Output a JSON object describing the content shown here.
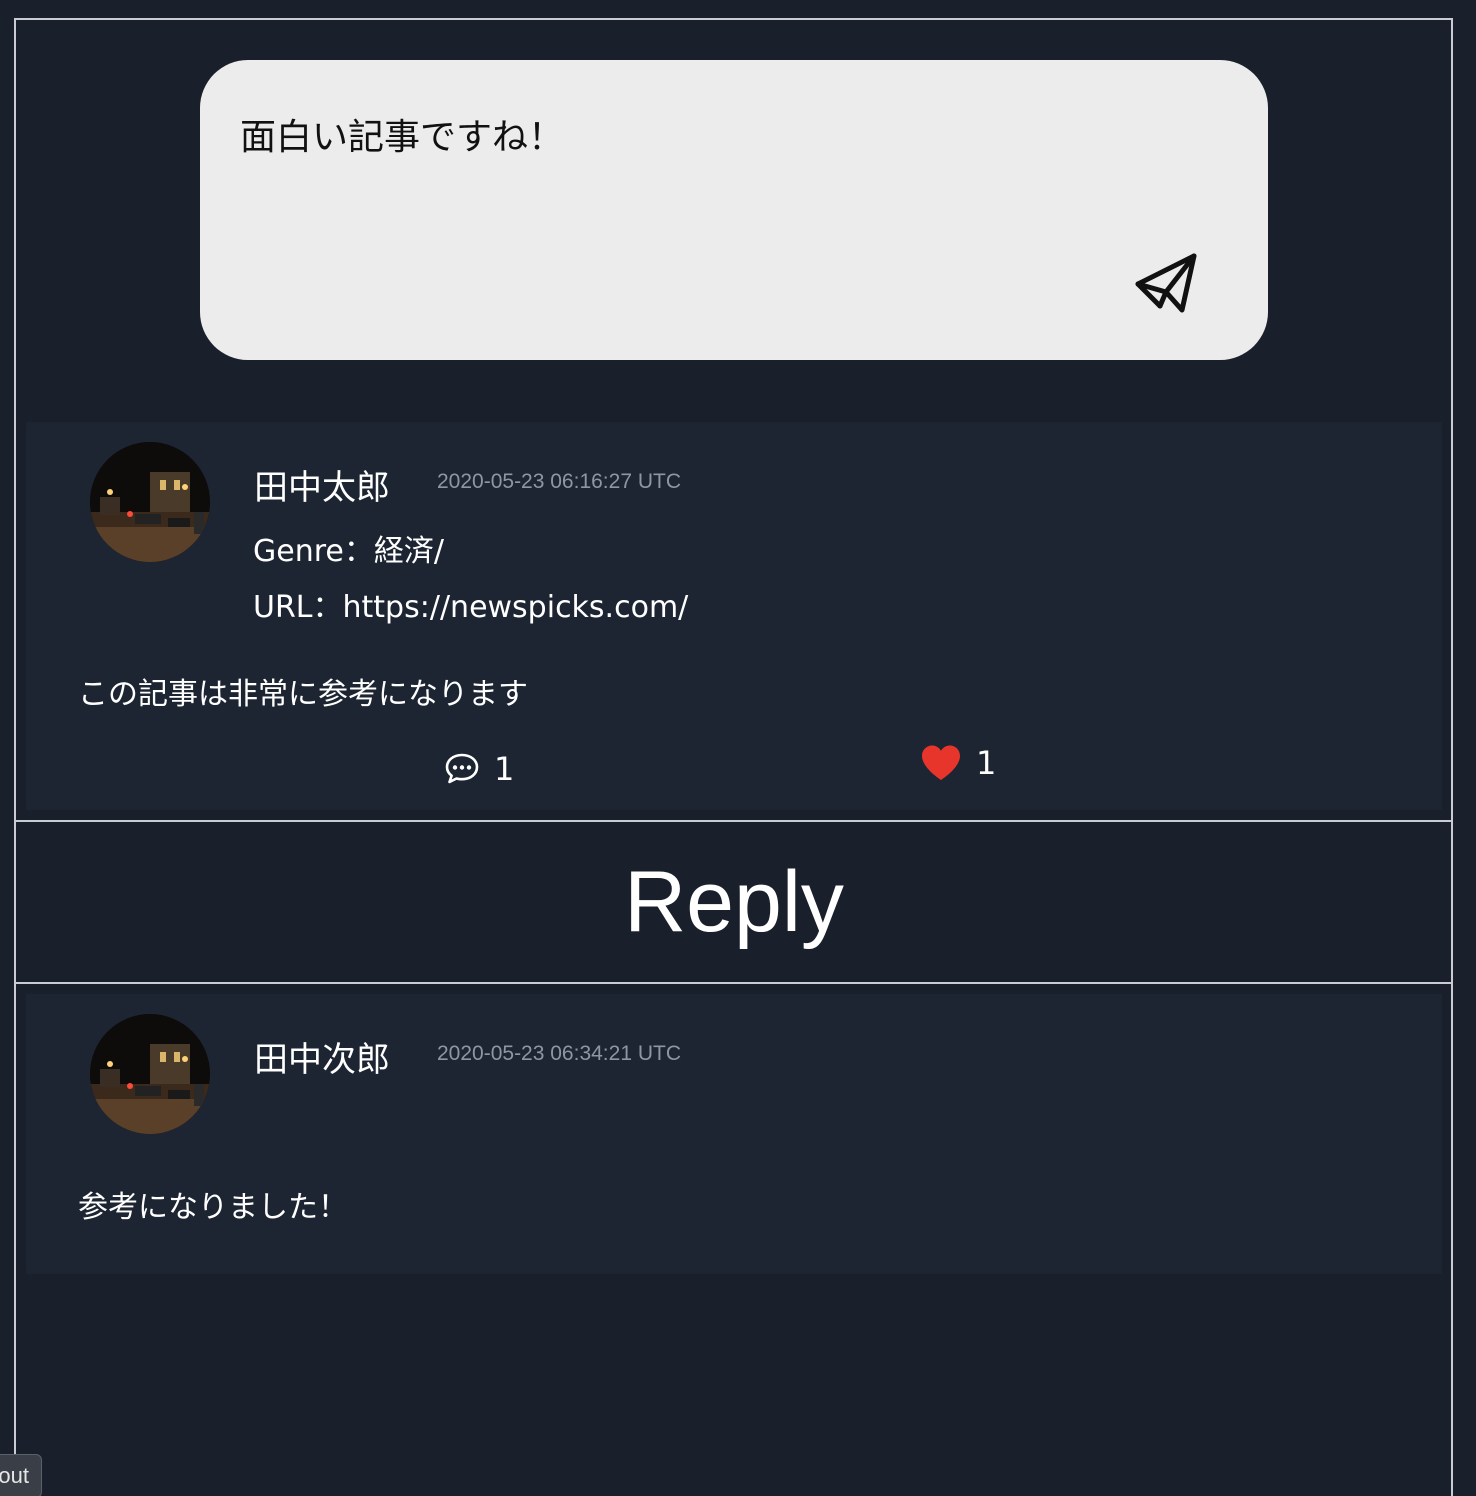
{
  "compose": {
    "value": "面白い記事ですね！",
    "send_icon": "paper-plane-icon"
  },
  "post": {
    "author": "田中太郎",
    "timestamp": "2020-05-23 06:16:27 UTC",
    "genre_line": "Genre：経済/",
    "url_line": "URL：https://newspicks.com/",
    "body": "この記事は非常に参考になります",
    "comment_icon": "speech-bubble-icon",
    "comment_count": "1",
    "like_icon": "heart-icon",
    "like_count": "1",
    "like_color": "#e8352b"
  },
  "reply_section": {
    "heading": "Reply"
  },
  "replies": [
    {
      "author": "田中次郎",
      "timestamp": "2020-05-23 06:34:21 UTC",
      "body": "参考になりました！"
    }
  ],
  "corner_button": {
    "label": "out"
  },
  "colors": {
    "background": "#19202c",
    "card": "#1d2533",
    "compose_bg": "#ececec",
    "timestamp": "#8f96a3"
  }
}
